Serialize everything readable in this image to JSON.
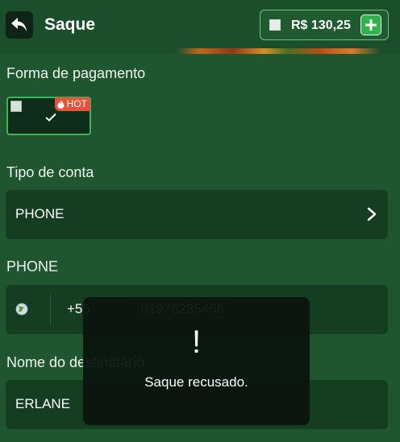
{
  "header": {
    "title": "Saque",
    "balance": "R$ 130,25"
  },
  "payment": {
    "label": "Forma de pagamento",
    "badge": "HOT"
  },
  "account_type": {
    "label": "Tipo de conta",
    "value": "PHONE"
  },
  "phone": {
    "label": "PHONE",
    "country_code": "+55",
    "number": "81976235466"
  },
  "recipient": {
    "label": "Nome do destinatário",
    "value": "ERLANE"
  },
  "toast": {
    "icon": "!",
    "message": "Saque recusado."
  },
  "colors": {
    "background": "#1f5630",
    "field": "#153d22",
    "accent_green": "#2fb24a",
    "hot_badge": "#e5533a"
  }
}
